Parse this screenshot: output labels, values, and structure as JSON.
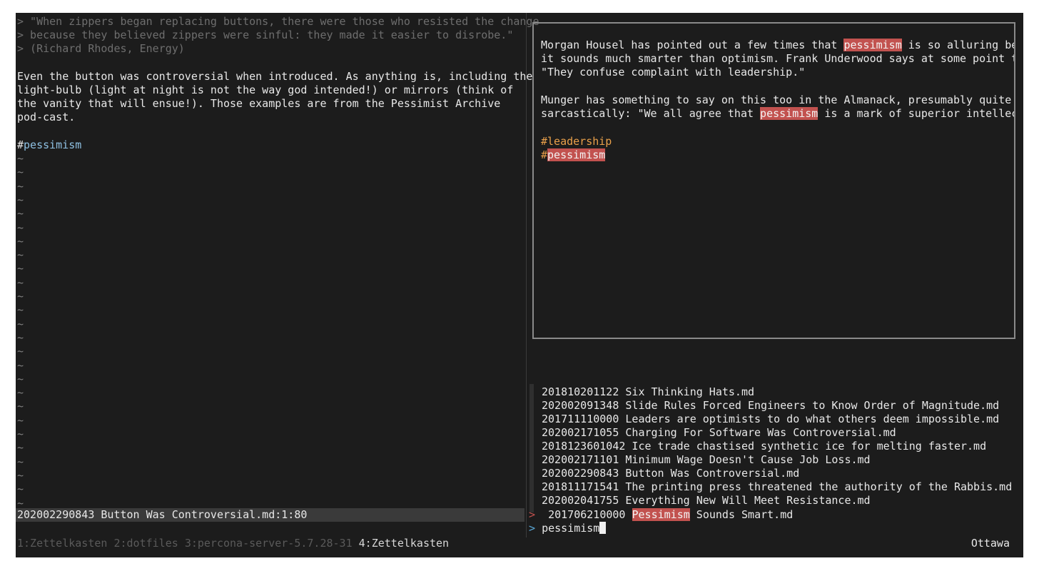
{
  "editor": {
    "quote_lines": [
      "> \"When zippers began replacing buttons, there were those who resisted the change",
      "> because they believed zippers were sinful: they made it easier to disrobe.\"",
      "> (Richard Rhodes, Energy)"
    ],
    "body_lines": [
      "Even the button was controversial when introduced. As anything is, including the",
      "light-bulb (light at night is not the way god intended!) or mirrors (think of",
      "the vanity that will ensue!). Those examples are from the Pessimist Archive",
      "pod-cast."
    ],
    "tag_hash": "#",
    "tag_name": "pessimism",
    "tilde": "~",
    "status_line": "202002290843 Button Was Controversial.md:1:80"
  },
  "preview": {
    "p1": {
      "l1_a": "Morgan Housel has pointed out a few times that ",
      "l1_hl": "pessimism",
      "l1_b": " is so alluring bec",
      "l2": "it sounds much smarter than optimism. Frank Underwood says at some point th",
      "l3": "\"They confuse complaint with leadership.\""
    },
    "p2": {
      "l1": "Munger has something to say on this too in the Almanack, presumably quite",
      "l2_a": "sarcastically: \"We all agree that ",
      "l2_hl": "pessimism",
      "l2_b": " is a mark of superior intellect"
    },
    "tag_leadership": "#leadership",
    "tag2_hash": "#",
    "tag2_name": "pessimism"
  },
  "results": {
    "items": [
      "201810201122 Six Thinking Hats.md",
      "202002091348 Slide Rules Forced Engineers to Know Order of Magnitude.md",
      "201711110000 Leaders are optimists to do what others deem impossible.md",
      "202002171055 Charging For Software Was Controversial.md",
      "2018123601042 Ice trade chastised synthetic ice for melting faster.md",
      "202002171101 Minimum Wage Doesn't Cause Job Loss.md",
      "202002290843 Button Was Controversial.md",
      "201811171541 The printing press threatened the authority of the Rabbis.md",
      "202002041755 Everything New Will Meet Resistance.md"
    ],
    "selected_marker": ">",
    "selected_id": "201706210000 ",
    "selected_hl": "Pessimism",
    "selected_rest": " Sounds Smart.md",
    "prompt_symbol": ">",
    "query": "pessimism"
  },
  "tmux": {
    "windows": [
      "1:Zettelkasten",
      "2:dotfiles",
      "3:percona-server-5.7.28-31"
    ],
    "active_window": "4:Zettelkasten",
    "session": "Ottawa"
  }
}
